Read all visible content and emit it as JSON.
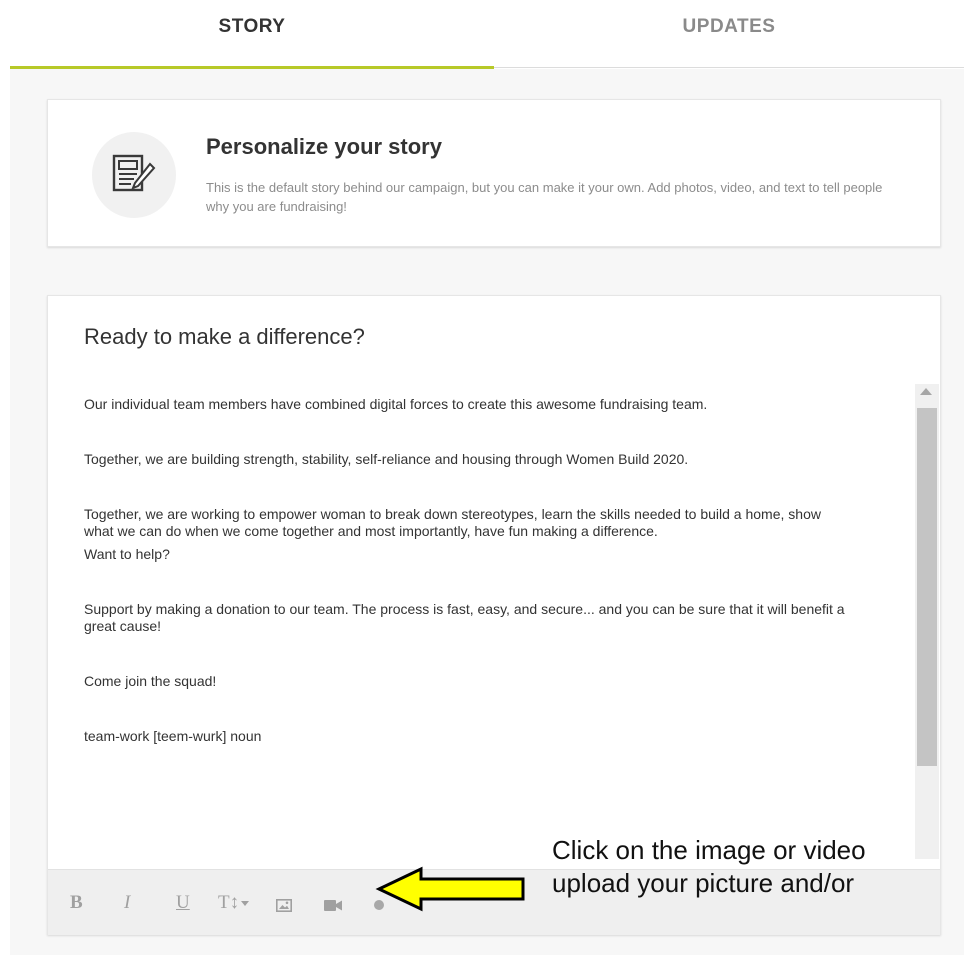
{
  "tabs": [
    {
      "label": "STORY",
      "active": true
    },
    {
      "label": "UPDATES",
      "active": false
    }
  ],
  "accent_color": "#b7c928",
  "personalize": {
    "icon": "document-edit-icon",
    "title": "Personalize your story",
    "description": "This is the default story behind our campaign, but you can make it your own. Add photos, video, and text to tell people why you are fundraising!"
  },
  "story": {
    "title": "Ready to make a difference?",
    "paragraphs": [
      "Our individual team members have combined digital forces to create this awesome fundraising team.",
      "Together, we are building strength, stability, self-reliance and housing through Women Build 2020.",
      "Together, we are working to empower woman to break down stereotypes, learn the skills needed to build a home, show what we can do when we come together and most importantly, have fun making a difference.",
      "Want to help?",
      "Support by making a donation to our team. The process is fast, easy, and secure... and you can be sure that it will benefit a great cause!",
      "Come join the squad!",
      "team-work [teem-wurk] noun"
    ]
  },
  "toolbar": {
    "bold": "B",
    "italic": "I",
    "underline": "U",
    "text_size": "T↕",
    "image_icon": "image-icon",
    "video_icon": "video-camera-icon"
  },
  "callout": {
    "line1": "Click on the image or video",
    "line2": "upload your picture and/or",
    "arrow_color": "#ffff00"
  }
}
